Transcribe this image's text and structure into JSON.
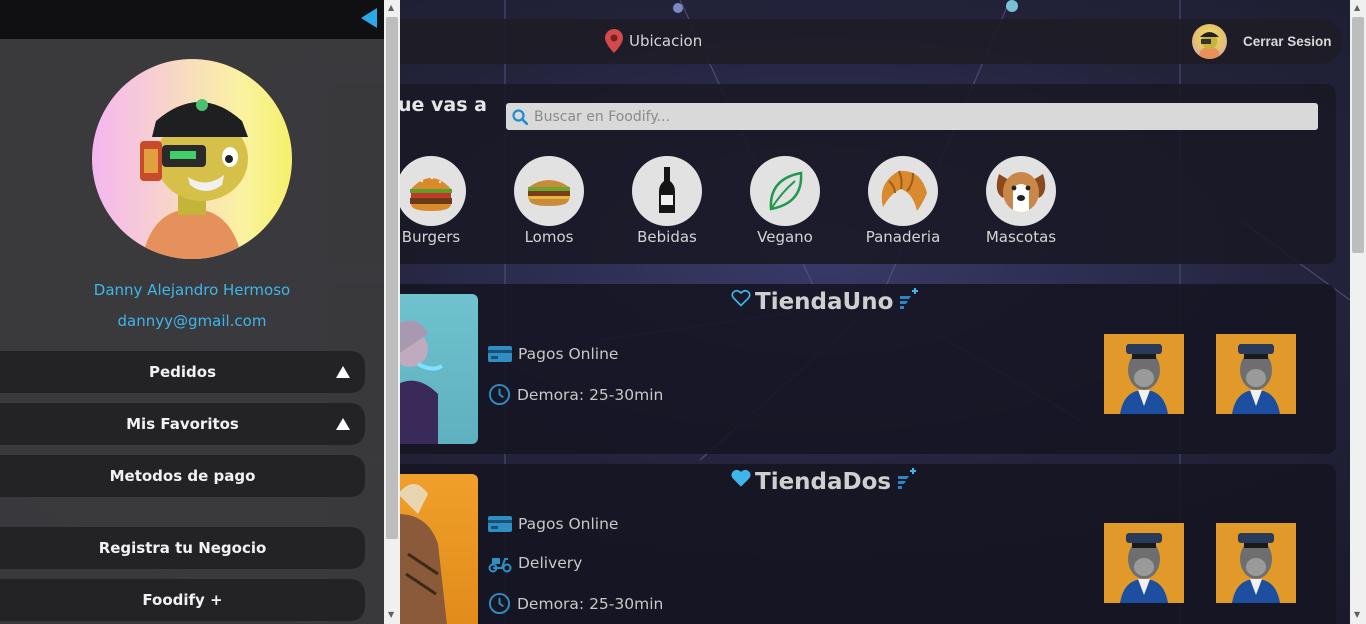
{
  "header": {
    "location_label": "Ubicacion",
    "logout_label": "Cerrar Sesion"
  },
  "search": {
    "question": "ue vas a",
    "placeholder": "Buscar en Foodify..."
  },
  "categories": [
    {
      "label": "Burgers",
      "icon": "burger-icon"
    },
    {
      "label": "Lomos",
      "icon": "sandwich-icon"
    },
    {
      "label": "Bebidas",
      "icon": "bottle-icon"
    },
    {
      "label": "Vegano",
      "icon": "leaf-icon"
    },
    {
      "label": "Panaderia",
      "icon": "croissant-icon"
    },
    {
      "label": "Mascotas",
      "icon": "dog-icon"
    }
  ],
  "stores": [
    {
      "name": "TiendaUno",
      "favorite": false,
      "features": [
        "Pagos Online",
        "Demora: 25-30min"
      ]
    },
    {
      "name": "TiendaDos",
      "favorite": true,
      "features": [
        "Pagos Online",
        "Delivery",
        "Demora: 25-30min"
      ]
    }
  ],
  "sidebar": {
    "user_name": "Danny Alejandro Hermoso",
    "user_email": "dannyy@gmail.com",
    "menu": [
      {
        "label": "Pedidos",
        "expandable": true
      },
      {
        "label": "Mis Favoritos",
        "expandable": true
      },
      {
        "label": "Metodos de pago",
        "expandable": false
      },
      {
        "label": "Registra tu Negocio",
        "expandable": false
      },
      {
        "label": "Foodify +",
        "expandable": false
      }
    ]
  },
  "colors": {
    "accent": "#3fb6ea",
    "sidebar_bg": "#3c3c3e",
    "menu_button": "#232326",
    "card_bg": "#141422"
  }
}
